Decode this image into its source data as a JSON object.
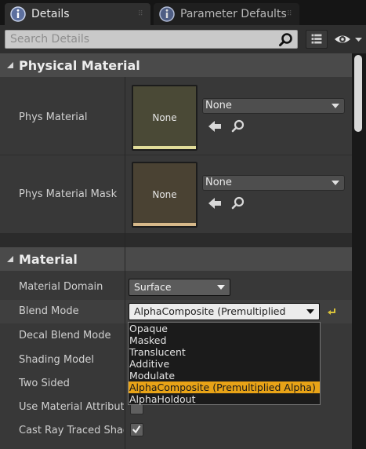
{
  "tabs": [
    {
      "label": "Details",
      "icon": "details-info-icon",
      "active": true
    },
    {
      "label": "Parameter Defaults",
      "icon": "parameter-info-icon",
      "active": false
    }
  ],
  "search": {
    "placeholder": "Search Details"
  },
  "categories": {
    "physical_material": "Physical Material",
    "material": "Material"
  },
  "physical_material": {
    "phys_material": {
      "label": "Phys Material",
      "thumb_text": "None",
      "value": "None"
    },
    "phys_material_mask": {
      "label": "Phys Material Mask",
      "thumb_text": "None",
      "value": "None"
    }
  },
  "material": {
    "domain": {
      "label": "Material Domain",
      "value": "Surface"
    },
    "blend_mode": {
      "label": "Blend Mode",
      "value": "AlphaComposite (Premultiplied Alpha)"
    },
    "decal_blend_mode": {
      "label": "Decal Blend Mode"
    },
    "shading_model": {
      "label": "Shading Model"
    },
    "two_sided": {
      "label": "Two Sided"
    },
    "use_material_attributes": {
      "label": "Use Material Attributes",
      "checked": false
    },
    "cast_ray_traced_shadows": {
      "label": "Cast Ray Traced Shadows",
      "checked": true
    }
  },
  "blend_mode_options": [
    "Opaque",
    "Masked",
    "Translucent",
    "Additive",
    "Modulate",
    "AlphaComposite (Premultiplied Alpha)",
    "AlphaHoldout"
  ],
  "blend_mode_selected_index": 5,
  "colors": {
    "accent_selected": "#e8a317",
    "phys_material_bar": "#e2dd9a",
    "phys_material_mask_bar": "#d7b98a",
    "reset_arrow": "#d9c23a"
  }
}
